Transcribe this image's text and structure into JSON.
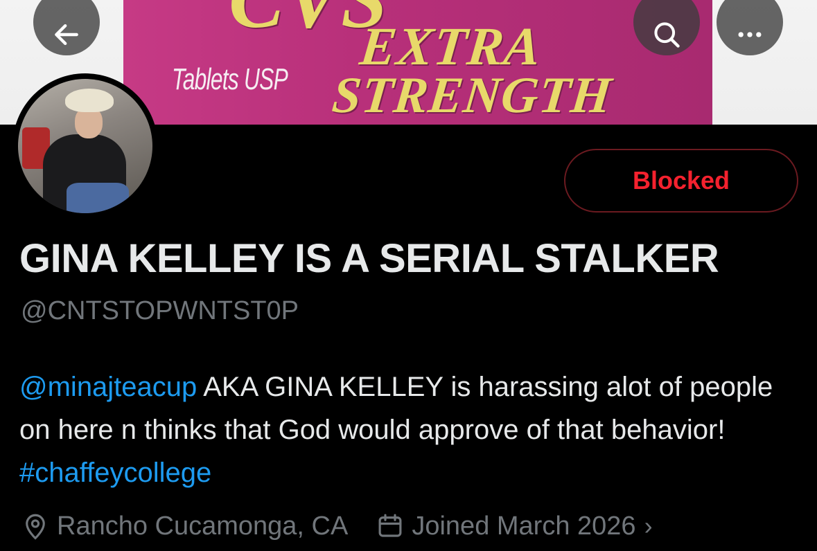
{
  "banner": {
    "text_top": "CVS",
    "text_extra": "EXTRA",
    "text_strength": "STRENGTH",
    "text_tablets": "Tablets USP"
  },
  "nav": {
    "back_icon": "arrow-left-icon",
    "search_icon": "search-icon",
    "more_icon": "more-horizontal-icon"
  },
  "profile": {
    "blocked_label": "Blocked",
    "display_name": "GINA KELLEY IS A SERIAL STALKER",
    "handle": "@CNTSTOPWNTST0P",
    "bio": {
      "mention": "@minajteacup",
      "text_1": " AKA GINA KELLEY is harassing alot of people on here n thinks that God would approve of that behavior! ",
      "hashtag": "#chaffeycollege"
    },
    "location": "Rancho Cucamonga, CA",
    "joined": "Joined March 2026"
  },
  "colors": {
    "background": "#000000",
    "text_primary": "#e7e9ea",
    "text_secondary": "#71767b",
    "link": "#1d9bf0",
    "blocked_red": "#f4212e"
  }
}
